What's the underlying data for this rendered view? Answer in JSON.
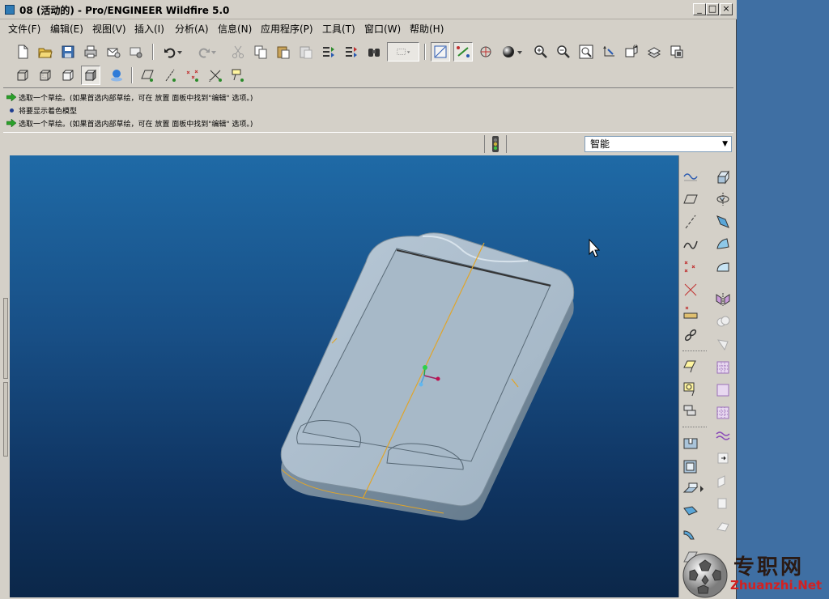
{
  "window": {
    "title": "08 (活动的) - Pro/ENGINEER Wildfire 5.0",
    "controls": [
      "_",
      "□",
      "×"
    ]
  },
  "menubar": {
    "items": [
      "文件(F)",
      "编辑(E)",
      "视图(V)",
      "插入(I)",
      "分析(A)",
      "信息(N)",
      "应用程序(P)",
      "工具(T)",
      "窗口(W)",
      "帮助(H)"
    ]
  },
  "messages": [
    {
      "icon": "green-arrow-icon",
      "text": "选取一个草绘。(如果首选内部草绘，可在 放置 面板中找到\"编辑\" 选项。)"
    },
    {
      "icon": "blue-dot-icon",
      "text": "将要显示着色模型"
    },
    {
      "icon": "green-arrow-icon",
      "text": "选取一个草绘。(如果首选内部草绘，可在 放置 面板中找到\"编辑\" 选项。)"
    }
  ],
  "statusbar": {
    "filter_value": "智能"
  },
  "watermark": {
    "cn": "专职网",
    "en": "Zhuanzhi.Net"
  },
  "colors": {
    "viewport_top": "#1f6aa6",
    "viewport_bottom": "#0b2749",
    "model": "#a9bccb",
    "datum_plane": "#e0a52a",
    "chrome": "#d4d0c8"
  }
}
